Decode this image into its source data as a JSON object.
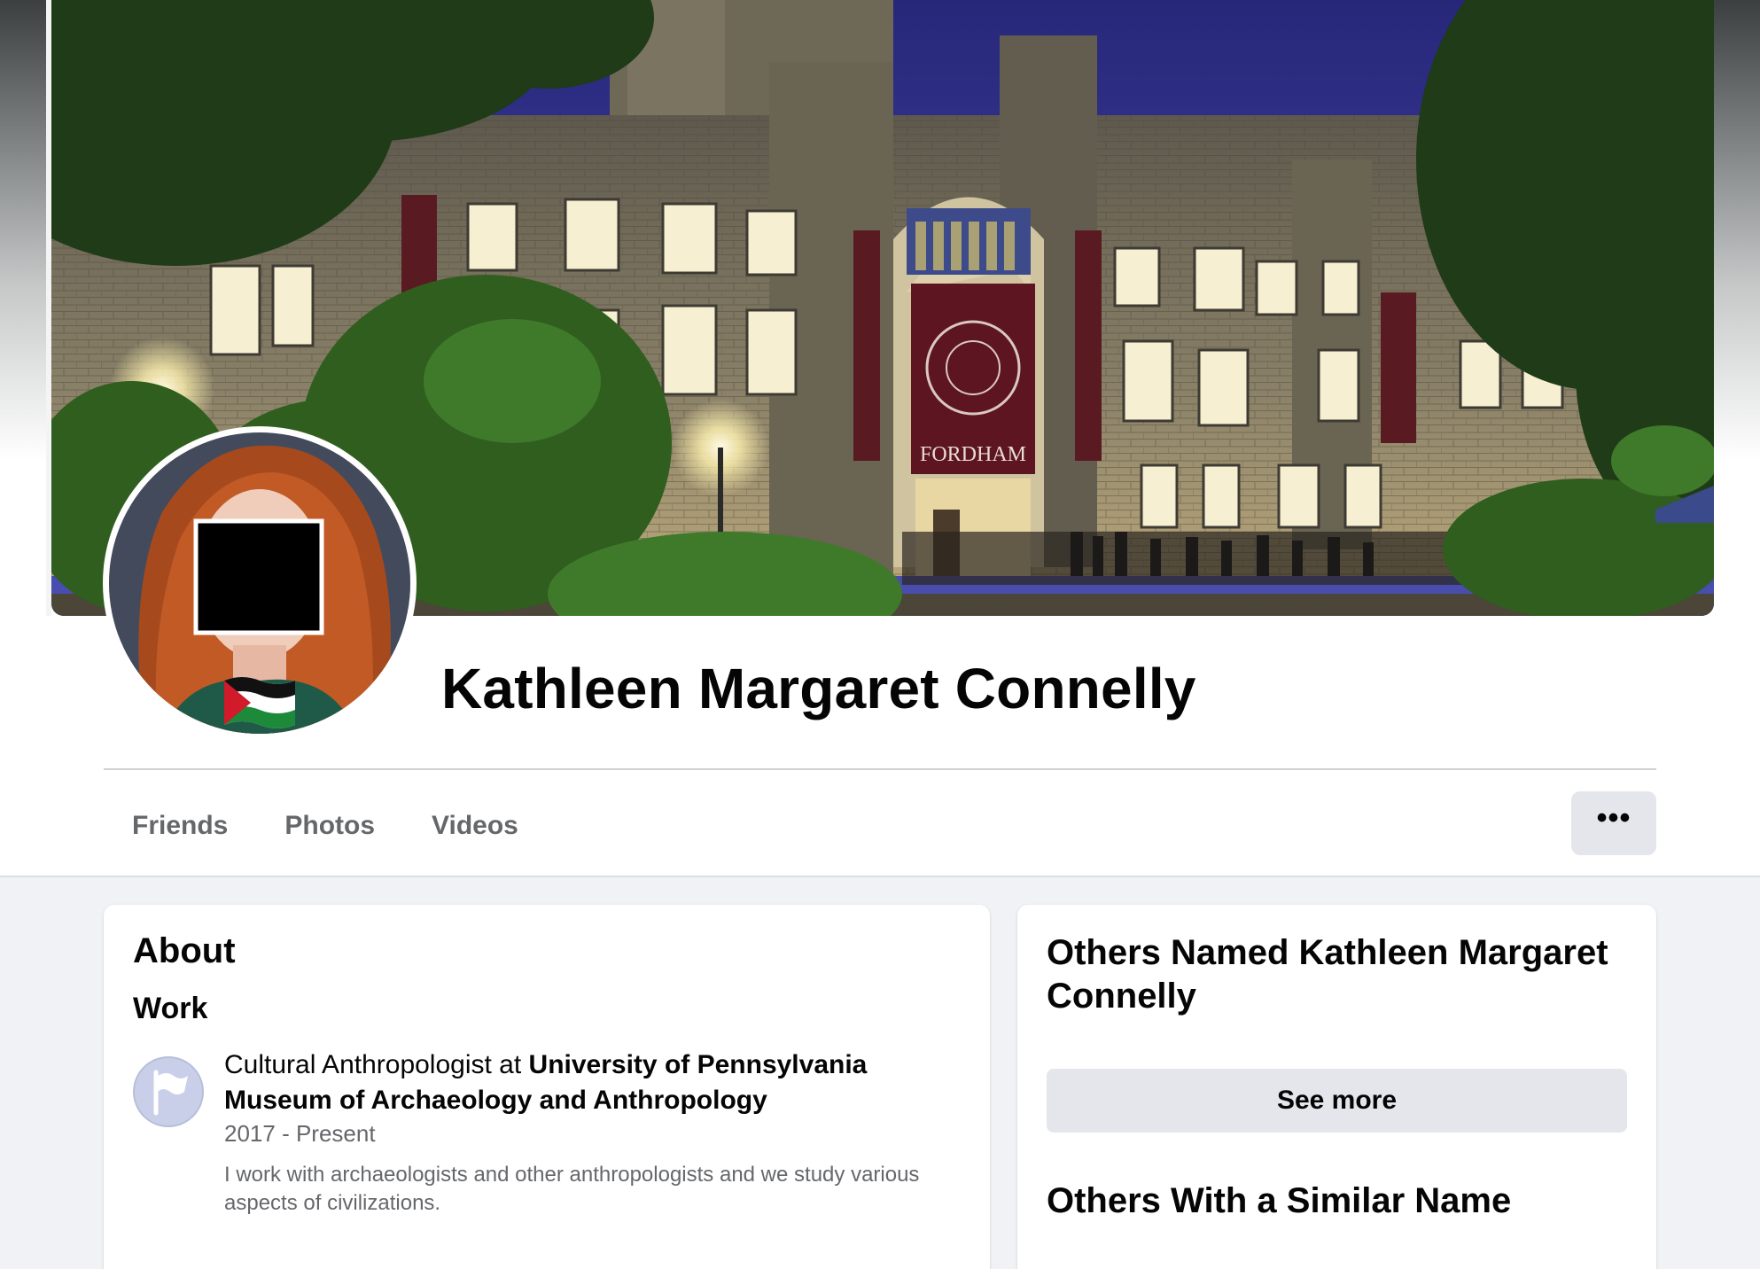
{
  "profile": {
    "name": "Kathleen Margaret Connelly",
    "cover_banner_text": "FORDHAM"
  },
  "tabs": [
    {
      "label": "Friends"
    },
    {
      "label": "Photos"
    },
    {
      "label": "Videos"
    }
  ],
  "more_button": {
    "label": "•••",
    "icon": "more-dots-icon"
  },
  "about": {
    "title": "About",
    "work_heading": "Work",
    "job": {
      "role_prefix": "Cultural Anthropologist at ",
      "employer": "University of Pennsylvania Museum of Archaeology and Anthropology",
      "dates": "2017 - Present",
      "description": "I work with archaeologists and other anthropologists and we study various aspects of civilizations.",
      "icon": "flag-icon"
    }
  },
  "others": {
    "title": "Others Named Kathleen Margaret Connelly",
    "see_more_label": "See more",
    "similar_title": "Others With a Similar Name"
  },
  "colors": {
    "page_bg": "#f0f2f5",
    "secondary_text": "#65676b",
    "button_bg": "#e4e6eb"
  }
}
